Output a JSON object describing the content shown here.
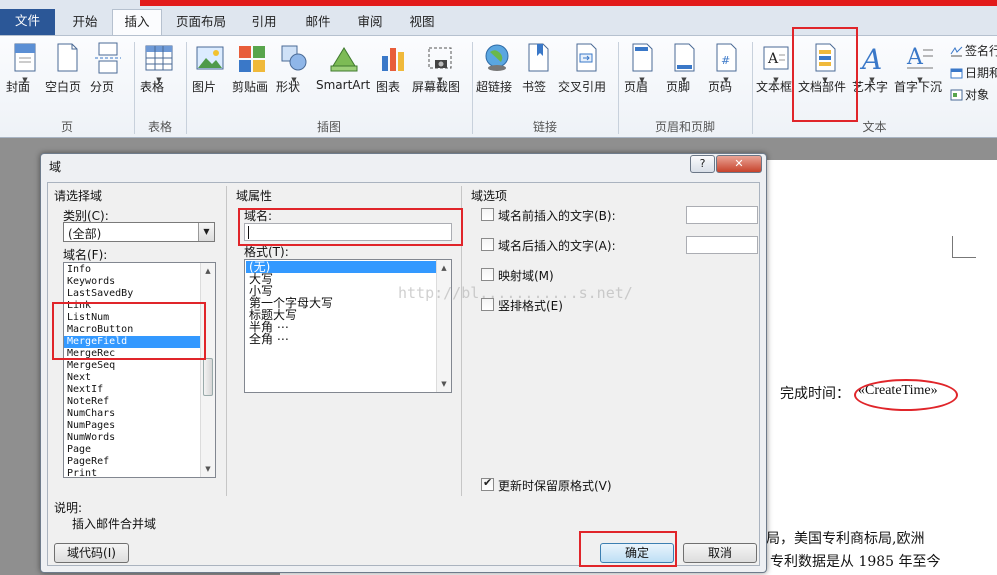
{
  "ribbon": {
    "tabs": [
      "文件",
      "开始",
      "插入",
      "页面布局",
      "引用",
      "邮件",
      "审阅",
      "视图"
    ],
    "active_tab": "插入",
    "buttons": {
      "cover": "封面",
      "blank_page": "空白页",
      "page_break": "分页",
      "table": "表格",
      "picture": "图片",
      "clipart": "剪贴画",
      "shapes": "形状",
      "smartart": "SmartArt",
      "chart": "图表",
      "screenshot": "屏幕截图",
      "hyperlink": "超链接",
      "bookmark": "书签",
      "crossref": "交叉引用",
      "header": "页眉",
      "footer": "页脚",
      "page_number": "页码",
      "textbox": "文本框",
      "quick_parts": "文档部件",
      "wordart": "艺术字",
      "dropcap": "首字下沉",
      "signature": "签名行",
      "datetime": "日期和",
      "object": "对象"
    },
    "groups": {
      "pages": "页",
      "tables": "表格",
      "illustrations": "插图",
      "links": "链接",
      "header_footer": "页眉和页脚",
      "text": "文本"
    }
  },
  "document": {
    "done_time_label": "完成时间：",
    "merge_field_value": "«CreateTime»",
    "line1": "局，美国专利商标局,欧洲",
    "line2": "专利数据是从 1985 年至今"
  },
  "dialog": {
    "title": "域",
    "help_label": "?",
    "close_label": "✕",
    "choose_field_heading": "请选择域",
    "category_label": "类别(C):",
    "category_value": "(全部)",
    "field_names_label": "域名(F):",
    "field_names": [
      "Info",
      "Keywords",
      "LastSavedBy",
      "Link",
      "ListNum",
      "MacroButton",
      "MergeField",
      "MergeRec",
      "MergeSeq",
      "Next",
      "NextIf",
      "NoteRef",
      "NumChars",
      "NumPages",
      "NumWords",
      "Page",
      "PageRef",
      "Print"
    ],
    "selected_field": "MergeField",
    "field_props_heading": "域属性",
    "field_name_label": "域名:",
    "field_name_value": "",
    "format_label": "格式(T):",
    "formats": [
      "(无)",
      "大写",
      "小写",
      "第一个字母大写",
      "标题大写",
      "半角 ⋯",
      "全角 ⋯"
    ],
    "selected_format": "(无)",
    "field_options_heading": "域选项",
    "options": [
      {
        "label": "域名前插入的文字(B):",
        "checked": false
      },
      {
        "label": "域名后插入的文字(A):",
        "checked": false
      },
      {
        "label": "映射域(M)",
        "checked": false
      },
      {
        "label": "竖排格式(E)",
        "checked": false
      }
    ],
    "preserve_format_label": "更新时保留原格式(V)",
    "preserve_format_checked": true,
    "description_label": "说明:",
    "description_text": "插入邮件合并域",
    "field_codes_button": "域代码(I)",
    "ok_button": "确定",
    "cancel_button": "取消"
  },
  "watermark_text": "http://bl...........s.net/",
  "colors": {
    "annotation_red": "#e0252a",
    "file_tab": "#2b5797",
    "selection": "#3399ff"
  }
}
